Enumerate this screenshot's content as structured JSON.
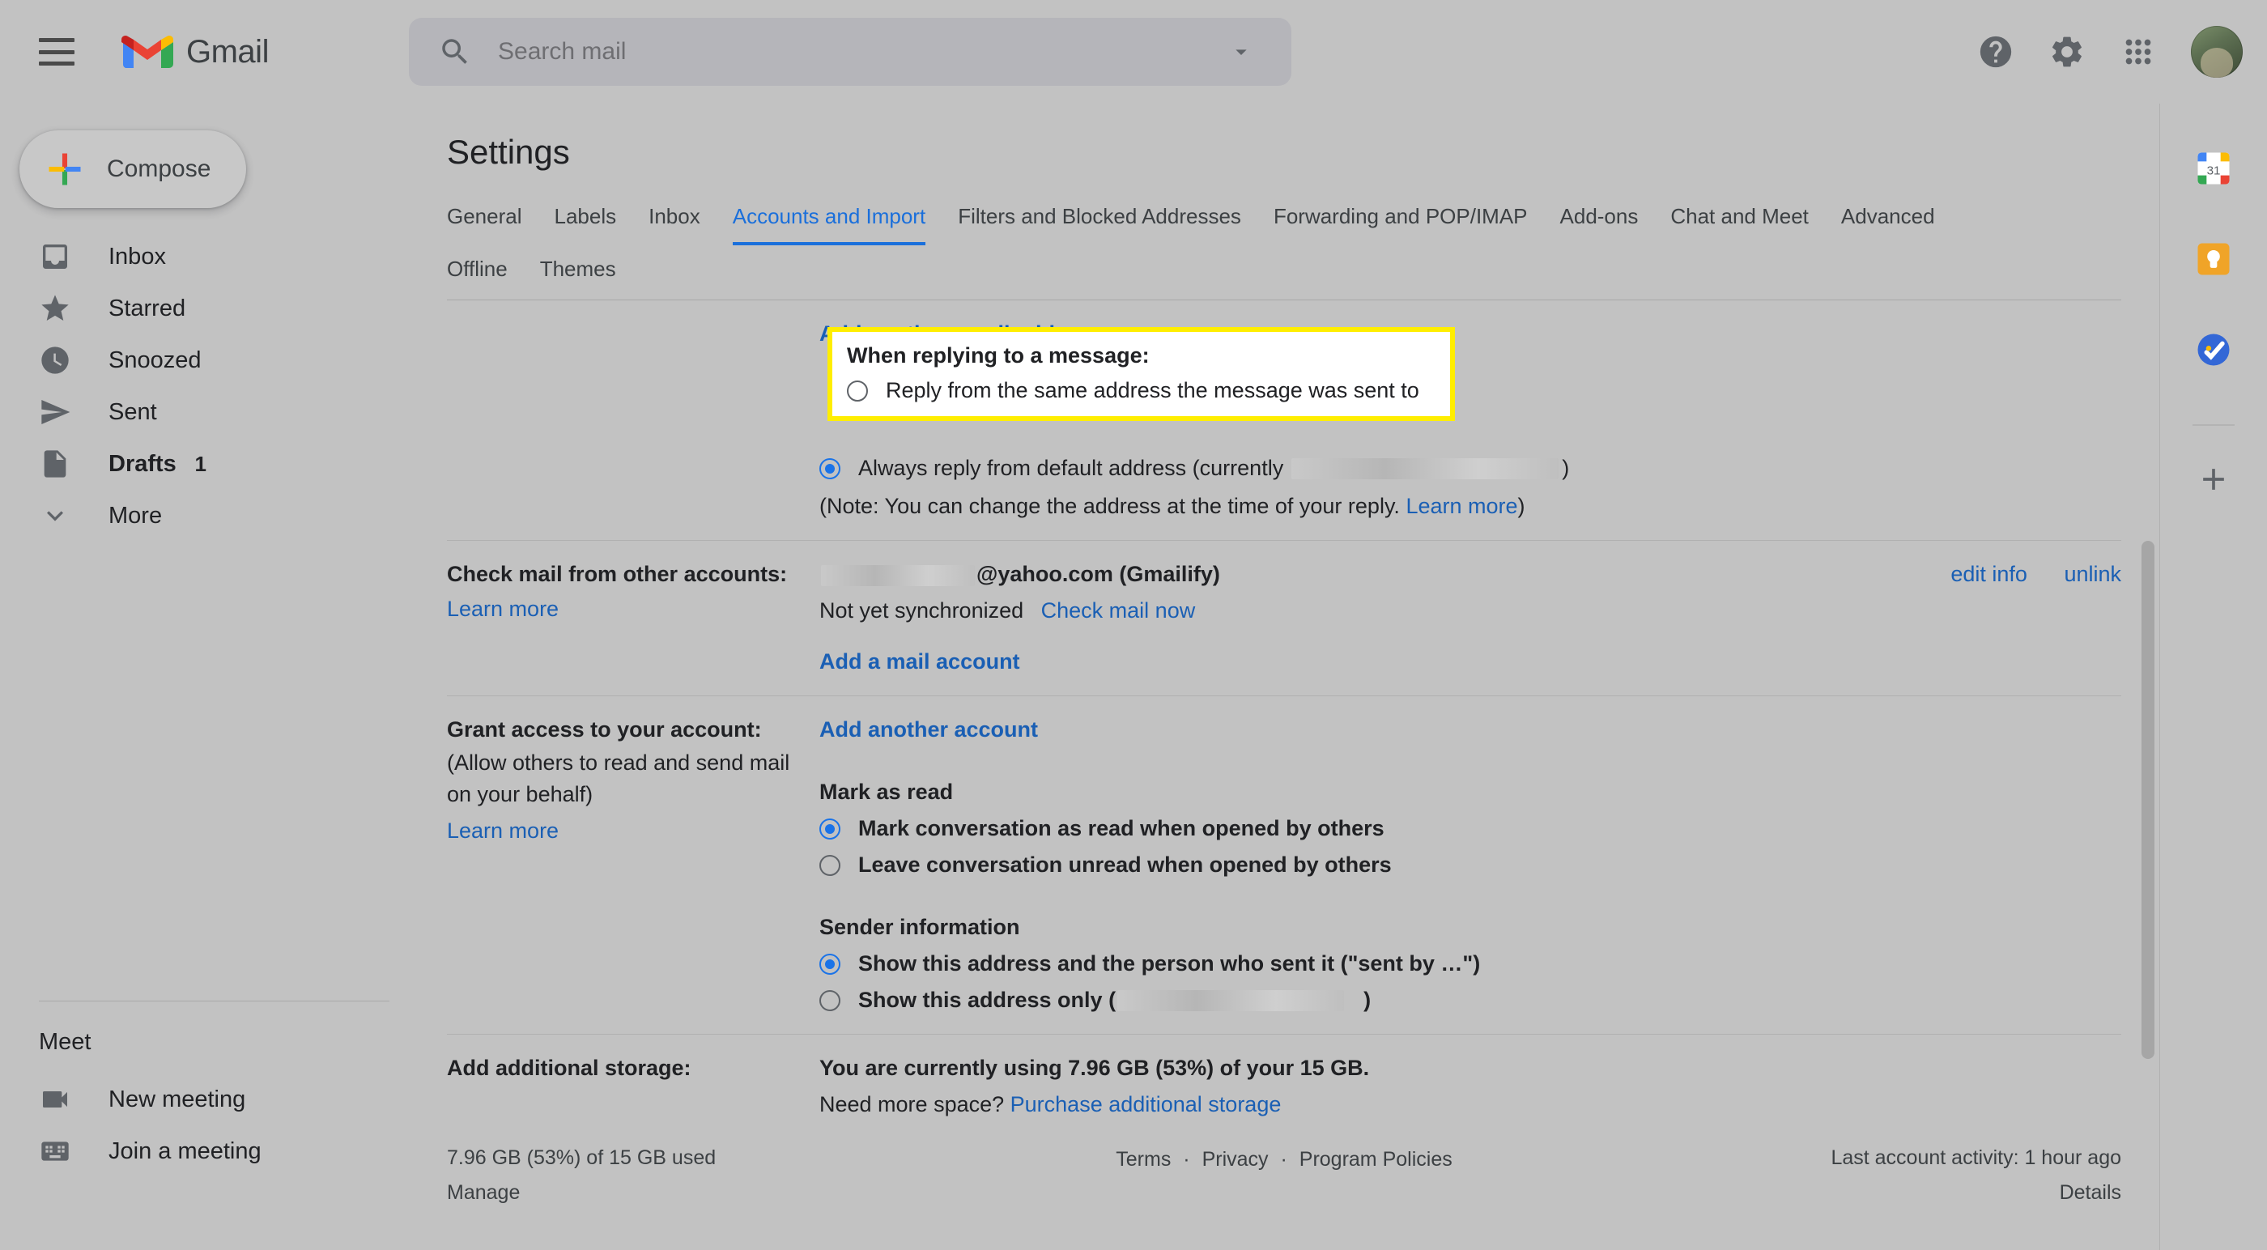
{
  "topbar": {
    "menu_icon": "hamburger-menu-icon",
    "brand": "Gmail",
    "search_placeholder": "Search mail",
    "search_value": "",
    "help_icon": "help-icon",
    "settings_icon": "gear-icon",
    "apps_icon": "apps-grid-icon",
    "avatar": "user-avatar"
  },
  "sidebar": {
    "compose_label": "Compose",
    "items": [
      {
        "label": "Inbox",
        "icon": "inbox-icon",
        "count": "",
        "bold": false
      },
      {
        "label": "Starred",
        "icon": "star-icon",
        "count": "",
        "bold": false
      },
      {
        "label": "Snoozed",
        "icon": "clock-icon",
        "count": "",
        "bold": false
      },
      {
        "label": "Sent",
        "icon": "send-icon",
        "count": "",
        "bold": false
      },
      {
        "label": "Drafts",
        "icon": "draft-file-icon",
        "count": "1",
        "bold": true
      },
      {
        "label": "More",
        "icon": "chevron-down-icon",
        "count": "",
        "bold": false
      }
    ],
    "meet_title": "Meet",
    "meet_items": [
      {
        "label": "New meeting",
        "icon": "video-camera-icon"
      },
      {
        "label": "Join a meeting",
        "icon": "keyboard-icon"
      }
    ]
  },
  "settings": {
    "title": "Settings",
    "tabs_row1": [
      {
        "label": "General",
        "active": false
      },
      {
        "label": "Labels",
        "active": false
      },
      {
        "label": "Inbox",
        "active": false
      },
      {
        "label": "Accounts and Import",
        "active": true
      },
      {
        "label": "Filters and Blocked Addresses",
        "active": false
      },
      {
        "label": "Forwarding and POP/IMAP",
        "active": false
      },
      {
        "label": "Add-ons",
        "active": false
      },
      {
        "label": "Chat and Meet",
        "active": false
      },
      {
        "label": "Advanced",
        "active": false
      }
    ],
    "tabs_row2": [
      {
        "label": "Offline",
        "active": false
      },
      {
        "label": "Themes",
        "active": false
      }
    ]
  },
  "send_mail_as": {
    "add_another_email": "Add another email address",
    "highlight": {
      "title": "When replying to a message:",
      "option_same_address": "Reply from the same address the message was sent to"
    },
    "option_default_prefix": "Always reply from default address (currently",
    "option_default_suffix": ")",
    "note_prefix": "(Note: You can change the address at the time of your reply. ",
    "note_link": "Learn more",
    "note_suffix": ")"
  },
  "check_mail": {
    "label": "Check mail from other accounts:",
    "learn_more": "Learn more",
    "account_domain": "@yahoo.com (Gmailify)",
    "status": "Not yet synchronized",
    "check_now": "Check mail now",
    "add_account": "Add a mail account",
    "edit_info": "edit info",
    "unlink": "unlink"
  },
  "grant_access": {
    "label": "Grant access to your account:",
    "sub": "(Allow others to read and send mail on your behalf)",
    "learn_more": "Learn more",
    "add_another_account": "Add another account",
    "mark_as_read_title": "Mark as read",
    "mark_opt1": "Mark conversation as read when opened by others",
    "mark_opt2": "Leave conversation unread when opened by others",
    "sender_info_title": "Sender information",
    "sender_opt1": "Show this address and the person who sent it (\"sent by …\")",
    "sender_opt2_prefix": "Show this address only (",
    "sender_opt2_suffix": ")"
  },
  "storage": {
    "label": "Add additional storage:",
    "usage": "You are currently using 7.96 GB (53%) of your 15 GB.",
    "need_space": "Need more space? ",
    "purchase_link": "Purchase additional storage"
  },
  "footer": {
    "storage_used": "7.96 GB (53%) of 15 GB used",
    "manage": "Manage",
    "terms": "Terms",
    "privacy": "Privacy",
    "program_policies": "Program Policies",
    "last_activity": "Last account activity: 1 hour ago",
    "details": "Details"
  },
  "rail": {
    "items": [
      {
        "icon": "google-calendar-icon"
      },
      {
        "icon": "google-keep-icon"
      },
      {
        "icon": "google-tasks-icon"
      }
    ],
    "add_icon": "add-plus-icon"
  },
  "colors": {
    "accent_blue": "#1a73e8",
    "link_blue": "#1a5fb4",
    "highlight_yellow": "#ffee00",
    "page_bg": "#c2c2c2"
  }
}
